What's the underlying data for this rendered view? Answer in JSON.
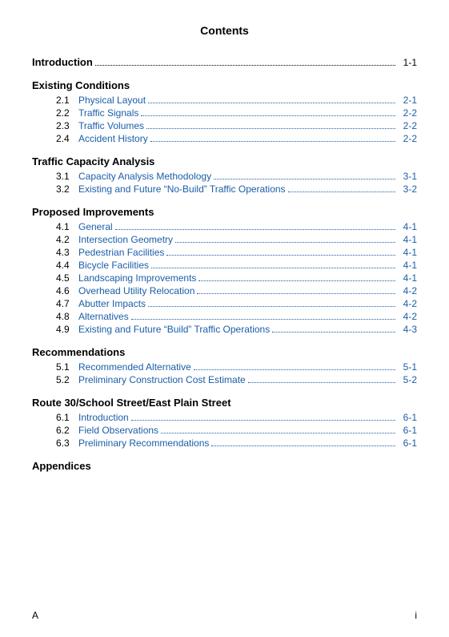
{
  "page": {
    "title": "Contents",
    "footer": {
      "left": "A",
      "right": "i"
    }
  },
  "toc": {
    "introduction": {
      "label": "Introduction",
      "page": "1-1"
    },
    "sections": [
      {
        "heading": "Existing Conditions",
        "entries": [
          {
            "number": "2.1",
            "title": "Physical Layout",
            "page": "2-1"
          },
          {
            "number": "2.2",
            "title": "Traffic Signals",
            "page": "2-2"
          },
          {
            "number": "2.3",
            "title": "Traffic Volumes",
            "page": "2-2"
          },
          {
            "number": "2.4",
            "title": "Accident History",
            "page": "2-2"
          }
        ]
      },
      {
        "heading": "Traffic Capacity Analysis",
        "entries": [
          {
            "number": "3.1",
            "title": "Capacity Analysis Methodology",
            "page": "3-1"
          },
          {
            "number": "3.2",
            "title": "Existing and Future “No-Build” Traffic Operations",
            "page": "3-2"
          }
        ]
      },
      {
        "heading": "Proposed Improvements",
        "entries": [
          {
            "number": "4.1",
            "title": "General",
            "page": "4-1"
          },
          {
            "number": "4.2",
            "title": "Intersection Geometry",
            "page": "4-1"
          },
          {
            "number": "4.3",
            "title": "Pedestrian Facilities",
            "page": "4-1"
          },
          {
            "number": "4.4",
            "title": "Bicycle Facilities",
            "page": "4-1"
          },
          {
            "number": "4.5",
            "title": "Landscaping Improvements",
            "page": "4-1"
          },
          {
            "number": "4.6",
            "title": "Overhead Utility Relocation",
            "page": "4-2"
          },
          {
            "number": "4.7",
            "title": "Abutter Impacts",
            "page": "4-2"
          },
          {
            "number": "4.8",
            "title": "Alternatives",
            "page": "4-2"
          },
          {
            "number": "4.9",
            "title": "Existing and Future “Build” Traffic Operations",
            "page": "4-3"
          }
        ]
      },
      {
        "heading": "Recommendations",
        "entries": [
          {
            "number": "5.1",
            "title": "Recommended Alternative",
            "page": "5-1"
          },
          {
            "number": "5.2",
            "title": "Preliminary Construction Cost Estimate",
            "page": "5-2"
          }
        ]
      },
      {
        "heading": "Route 30/School Street/East Plain Street",
        "entries": [
          {
            "number": "6.1",
            "title": "Introduction",
            "page": "6-1"
          },
          {
            "number": "6.2",
            "title": "Field Observations",
            "page": "6-1"
          },
          {
            "number": "6.3",
            "title": "Preliminary Recommendations",
            "page": "6-1"
          }
        ]
      },
      {
        "heading": "Appendices",
        "entries": []
      }
    ]
  }
}
